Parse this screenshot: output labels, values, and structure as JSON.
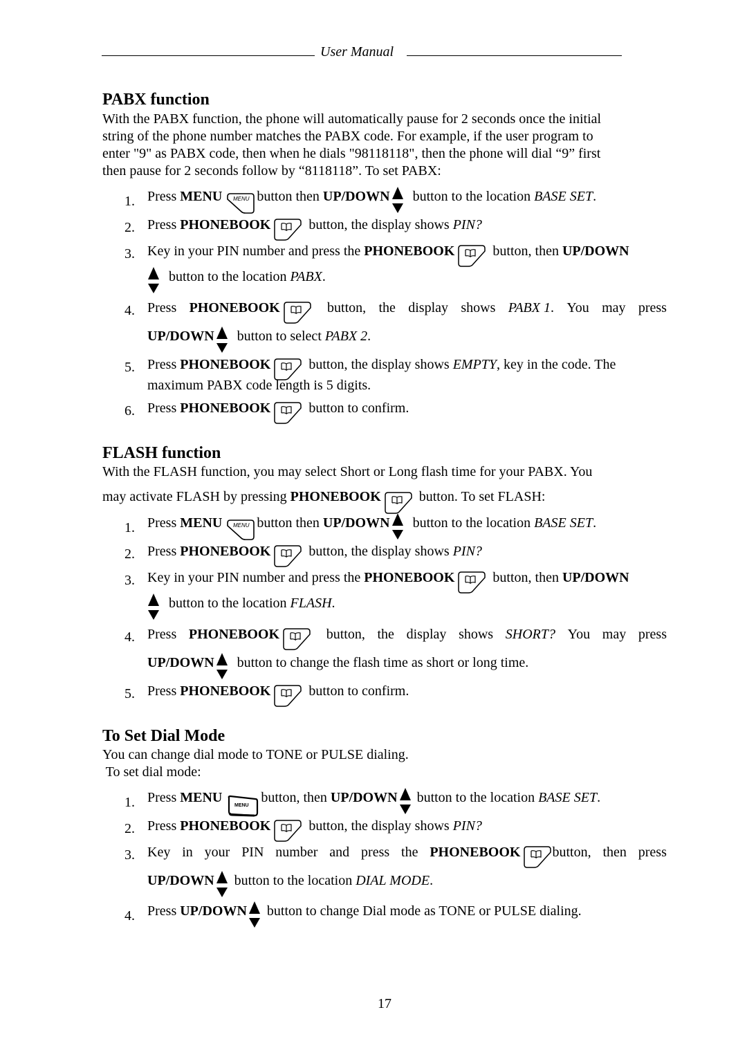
{
  "header": {
    "title": "User Manual"
  },
  "sections": [
    {
      "heading": "PABX function",
      "intro": [
        "With the PABX function, the phone will automatically pause for 2 seconds once the initial",
        "string of the phone number matches the PABX code. For example, if the user program to",
        "enter \"9\" as PABX code, then when he dials \"98118118\", then the phone will dial “9” first",
        "then pause for 2 seconds follow by “8118118”. To set PABX:"
      ],
      "steps": [
        {
          "n": "1.",
          "pre": "Press ",
          "k1": "MENU",
          "mid": "button then ",
          "k2": "UP/DOWN",
          "post": " button to the location ",
          "em": "BASE SET",
          "end": "."
        },
        {
          "n": "2.",
          "pre": "Press ",
          "k1": "PHONEBOOK",
          "mid": " button, the display shows ",
          "em": "PIN?"
        },
        {
          "n": "3.",
          "pre": "Key in your PIN number and press the ",
          "k1": "PHONEBOOK",
          "mid": " button, then ",
          "k2": "UP/DOWN",
          "cont": " button to the location ",
          "em": "PABX",
          "end": "."
        },
        {
          "n": "4.",
          "a": "Press",
          "k1": "PHONEBOOK",
          "b": "button,",
          "c": "the",
          "d": "display",
          "e": "shows",
          "em": "PABX 1",
          "f": ".",
          "g": "You",
          "h": "may",
          "i": "press",
          "k2": "UP/DOWN",
          "cont": " button to select ",
          "em2": "PABX 2",
          "end": "."
        },
        {
          "n": "5.",
          "pre": "Press ",
          "k1": "PHONEBOOK",
          "mid": " button, the display shows ",
          "em": "EMPTY",
          "post": ", key in the code. The",
          "line2": "maximum PABX code length is 5 digits."
        },
        {
          "n": "6.",
          "pre": "Press ",
          "k1": "PHONEBOOK",
          "mid": " button to confirm."
        }
      ]
    },
    {
      "heading": "FLASH function",
      "intro": [
        "With the FLASH function, you may select Short or Long flash time for your PABX. You"
      ],
      "intro2": {
        "pre": "may activate FLASH by pressing ",
        "k": "PHONEBOOK",
        "post": " button. To set FLASH:"
      },
      "steps": [
        {
          "n": "1.",
          "pre": "Press ",
          "k1": "MENU",
          "mid": "button then ",
          "k2": "UP/DOWN",
          "post": " button to the location ",
          "em": "BASE SET",
          "end": "."
        },
        {
          "n": "2.",
          "pre": "Press ",
          "k1": "PHONEBOOK",
          "mid": " button, the display shows ",
          "em": "PIN?"
        },
        {
          "n": "3.",
          "pre": "Key in your PIN number and press the ",
          "k1": "PHONEBOOK",
          "mid": " button, then ",
          "k2": "UP/DOWN",
          "cont": " button to the location ",
          "em": "FLASH",
          "end": "."
        },
        {
          "n": "4.",
          "a": "Press",
          "k1": "PHONEBOOK",
          "b": "button,",
          "c": "the",
          "d": "display",
          "e": "shows",
          "em": "SHORT?",
          "g": "You",
          "h": "may",
          "i": "press",
          "k2": "UP/DOWN",
          "cont": " button to change the flash time as short or long time."
        },
        {
          "n": "5.",
          "pre": "Press ",
          "k1": "PHONEBOOK",
          "mid": " button to confirm."
        }
      ]
    },
    {
      "heading": "To Set Dial Mode",
      "intro": [
        "You can change dial mode to TONE or PULSE dialing.",
        " To set dial mode:"
      ],
      "steps": [
        {
          "n": "1.",
          "pre": "Press ",
          "k1": "MENU",
          "mid": "button, then ",
          "k2": "UP/DOWN",
          "post": "button to the location ",
          "em": "BASE SET",
          "end": "."
        },
        {
          "n": "2.",
          "pre": "Press ",
          "k1": "PHONEBOOK",
          "mid": " button, the display shows ",
          "em": "PIN?"
        },
        {
          "n": "3.",
          "a": "Key",
          "b": "in",
          "c": "your",
          "d": "PIN",
          "e": "number",
          "f": "and",
          "g": "press",
          "h": "the",
          "k1": "PHONEBOOK",
          "i": "button,",
          "j": "then",
          "k": "press",
          "k2": "UP/DOWN",
          "cont": " button to the location ",
          "em": "DIAL MODE",
          "end": "."
        },
        {
          "n": "4.",
          "pre": "Press ",
          "k2": "UP/DOWN",
          "post": " button to change Dial mode as TONE or PULSE dialing."
        }
      ]
    }
  ],
  "icons": {
    "menu": "menu-key-icon",
    "phonebook": "phonebook-key-icon",
    "updown": "up-down-arrows-icon"
  },
  "menu_key_label": "MENU",
  "page_number": "17"
}
